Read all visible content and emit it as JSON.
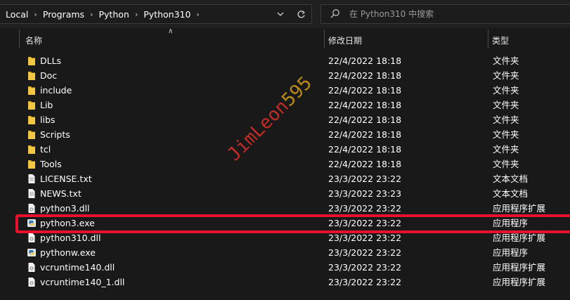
{
  "address": {
    "crumbs": [
      "Local",
      "Programs",
      "Python",
      "Python310"
    ]
  },
  "search": {
    "placeholder": "在 Python310 中搜索"
  },
  "columns": {
    "name": "名称",
    "modified": "修改日期",
    "type": "类型"
  },
  "files": [
    {
      "name": "DLLs",
      "date": "22/4/2022 18:18",
      "type": "文件夹",
      "icon": "folder-icon"
    },
    {
      "name": "Doc",
      "date": "22/4/2022 18:18",
      "type": "文件夹",
      "icon": "folder-icon"
    },
    {
      "name": "include",
      "date": "22/4/2022 18:18",
      "type": "文件夹",
      "icon": "folder-icon"
    },
    {
      "name": "Lib",
      "date": "22/4/2022 18:18",
      "type": "文件夹",
      "icon": "folder-icon"
    },
    {
      "name": "libs",
      "date": "22/4/2022 18:18",
      "type": "文件夹",
      "icon": "folder-icon"
    },
    {
      "name": "Scripts",
      "date": "22/4/2022 18:18",
      "type": "文件夹",
      "icon": "folder-icon"
    },
    {
      "name": "tcl",
      "date": "22/4/2022 18:18",
      "type": "文件夹",
      "icon": "folder-icon"
    },
    {
      "name": "Tools",
      "date": "22/4/2022 18:18",
      "type": "文件夹",
      "icon": "folder-icon"
    },
    {
      "name": "LICENSE.txt",
      "date": "23/3/2022 23:22",
      "type": "文本文档",
      "icon": "text-file-icon"
    },
    {
      "name": "NEWS.txt",
      "date": "23/3/2022 23:23",
      "type": "文本文档",
      "icon": "text-file-icon"
    },
    {
      "name": "python3.dll",
      "date": "23/3/2022 23:22",
      "type": "应用程序扩展",
      "icon": "dll-file-icon"
    },
    {
      "name": "python3.exe",
      "date": "23/3/2022 23:22",
      "type": "应用程序",
      "icon": "python-exe-icon"
    },
    {
      "name": "python310.dll",
      "date": "23/3/2022 23:22",
      "type": "应用程序扩展",
      "icon": "dll-file-icon"
    },
    {
      "name": "pythonw.exe",
      "date": "23/3/2022 23:22",
      "type": "应用程序",
      "icon": "python-exe-icon"
    },
    {
      "name": "vcruntime140.dll",
      "date": "23/3/2022 23:22",
      "type": "应用程序扩展",
      "icon": "dll-file-icon"
    },
    {
      "name": "vcruntime140_1.dll",
      "date": "23/3/2022 23:22",
      "type": "应用程序扩展",
      "icon": "dll-file-icon"
    }
  ],
  "watermark": {
    "text_a": "JimLeon",
    "text_b": "595"
  },
  "colors": {
    "folder": "#e8b730",
    "highlight": "#e8112d"
  }
}
